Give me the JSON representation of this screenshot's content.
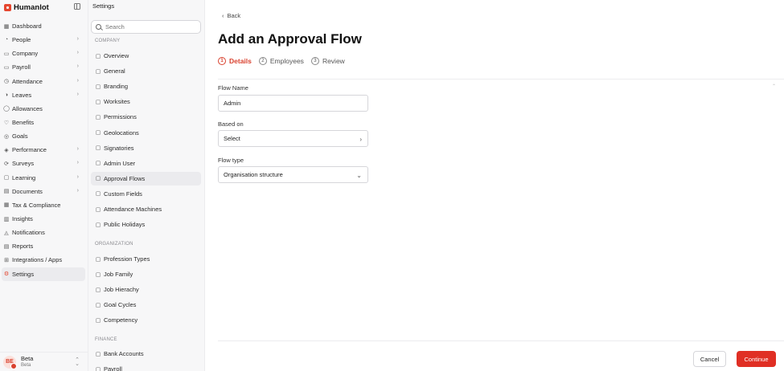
{
  "brand": {
    "name": "Humanlot"
  },
  "nav": {
    "items": [
      {
        "label": "Dashboard",
        "icon": "▦",
        "chevron": false
      },
      {
        "label": "People",
        "icon": "◔",
        "chevron": true
      },
      {
        "label": "Company",
        "icon": "▭",
        "chevron": true
      },
      {
        "label": "Payroll",
        "icon": "▭",
        "chevron": true
      },
      {
        "label": "Attendance",
        "icon": "◷",
        "chevron": true
      },
      {
        "label": "Leaves",
        "icon": "◑",
        "chevron": true
      },
      {
        "label": "Allowances",
        "icon": "◯",
        "chevron": false
      },
      {
        "label": "Benefits",
        "icon": "♡",
        "chevron": false
      },
      {
        "label": "Goals",
        "icon": "◎",
        "chevron": false
      },
      {
        "label": "Performance",
        "icon": "◈",
        "chevron": true
      },
      {
        "label": "Surveys",
        "icon": "⟳",
        "chevron": true
      },
      {
        "label": "Learning",
        "icon": "▢",
        "chevron": true
      },
      {
        "label": "Documents",
        "icon": "▤",
        "chevron": true
      },
      {
        "label": "Tax & Compliance",
        "icon": "▦",
        "chevron": false
      },
      {
        "label": "Insights",
        "icon": "▥",
        "chevron": false
      },
      {
        "label": "Notifications",
        "icon": "◬",
        "chevron": false
      },
      {
        "label": "Reports",
        "icon": "▤",
        "chevron": false
      },
      {
        "label": "Integrations / Apps",
        "icon": "⊞",
        "chevron": false
      },
      {
        "label": "Settings",
        "icon": "⚙",
        "chevron": false,
        "active": true
      }
    ]
  },
  "user": {
    "initials": "BE",
    "name": "Beta",
    "subtitle": "Beta"
  },
  "settings": {
    "title": "Settings",
    "search_placeholder": "Search",
    "sections": [
      {
        "label": "COMPANY",
        "items": [
          "Overview",
          "General",
          "Branding",
          "Worksites",
          "Permissions",
          "Geolocations",
          "Signatories",
          "Admin User",
          "Approval Flows",
          "Custom Fields",
          "Attendance Machines",
          "Public Holidays"
        ]
      },
      {
        "label": "ORGANIZATION",
        "items": [
          "Profession Types",
          "Job Family",
          "Job Hierachy",
          "Goal Cycles",
          "Competency"
        ]
      },
      {
        "label": "FINANCE",
        "items": [
          "Bank Accounts",
          "Payroll"
        ]
      }
    ],
    "active_item": "Approval Flows"
  },
  "main": {
    "back_label": "Back",
    "title": "Add an Approval Flow",
    "steps": [
      {
        "num": "1",
        "label": "Details",
        "active": true
      },
      {
        "num": "2",
        "label": "Employees",
        "active": false
      },
      {
        "num": "3",
        "label": "Review",
        "active": false
      }
    ],
    "flow_name_label": "Flow Name",
    "flow_name_value": "Admin",
    "based_on_label": "Based on",
    "based_on_value": "Select",
    "flow_type_label": "Flow type",
    "flow_type_value": "Organisation structure",
    "cancel_label": "Cancel",
    "continue_label": "Continue"
  },
  "colors": {
    "accent": "#e02f24",
    "active_step": "#d9422f"
  }
}
